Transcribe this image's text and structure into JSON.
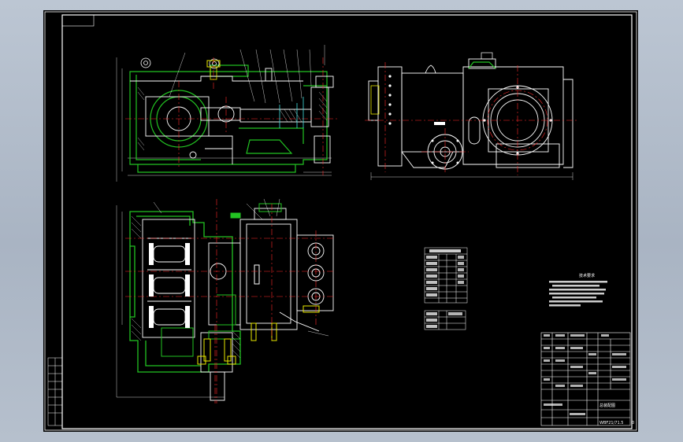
{
  "app": {
    "viewport_bg": "#b7c1ce",
    "canvas_bg": "#000000"
  },
  "colors": {
    "frame": "#ffffff",
    "red": "#ff2a2a",
    "green": "#22c322",
    "yellow": "#e8e800",
    "cyan": "#40e0e0",
    "magenta": "#ff3aff"
  },
  "drawing": {
    "title_block_name": "总装配图",
    "title_block_code": "WBF21/71.5",
    "sheet_mark": "0",
    "tech_req_heading": "技术要求"
  },
  "icons": {
    "crosshair": "crosshair-icon"
  }
}
